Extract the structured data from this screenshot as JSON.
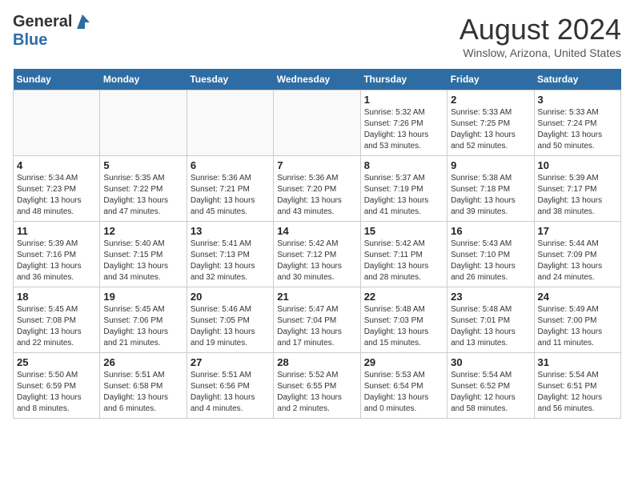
{
  "header": {
    "logo_general": "General",
    "logo_blue": "Blue",
    "month_title": "August 2024",
    "location": "Winslow, Arizona, United States"
  },
  "weekdays": [
    "Sunday",
    "Monday",
    "Tuesday",
    "Wednesday",
    "Thursday",
    "Friday",
    "Saturday"
  ],
  "weeks": [
    [
      {
        "day": "",
        "info": ""
      },
      {
        "day": "",
        "info": ""
      },
      {
        "day": "",
        "info": ""
      },
      {
        "day": "",
        "info": ""
      },
      {
        "day": "1",
        "info": "Sunrise: 5:32 AM\nSunset: 7:26 PM\nDaylight: 13 hours\nand 53 minutes."
      },
      {
        "day": "2",
        "info": "Sunrise: 5:33 AM\nSunset: 7:25 PM\nDaylight: 13 hours\nand 52 minutes."
      },
      {
        "day": "3",
        "info": "Sunrise: 5:33 AM\nSunset: 7:24 PM\nDaylight: 13 hours\nand 50 minutes."
      }
    ],
    [
      {
        "day": "4",
        "info": "Sunrise: 5:34 AM\nSunset: 7:23 PM\nDaylight: 13 hours\nand 48 minutes."
      },
      {
        "day": "5",
        "info": "Sunrise: 5:35 AM\nSunset: 7:22 PM\nDaylight: 13 hours\nand 47 minutes."
      },
      {
        "day": "6",
        "info": "Sunrise: 5:36 AM\nSunset: 7:21 PM\nDaylight: 13 hours\nand 45 minutes."
      },
      {
        "day": "7",
        "info": "Sunrise: 5:36 AM\nSunset: 7:20 PM\nDaylight: 13 hours\nand 43 minutes."
      },
      {
        "day": "8",
        "info": "Sunrise: 5:37 AM\nSunset: 7:19 PM\nDaylight: 13 hours\nand 41 minutes."
      },
      {
        "day": "9",
        "info": "Sunrise: 5:38 AM\nSunset: 7:18 PM\nDaylight: 13 hours\nand 39 minutes."
      },
      {
        "day": "10",
        "info": "Sunrise: 5:39 AM\nSunset: 7:17 PM\nDaylight: 13 hours\nand 38 minutes."
      }
    ],
    [
      {
        "day": "11",
        "info": "Sunrise: 5:39 AM\nSunset: 7:16 PM\nDaylight: 13 hours\nand 36 minutes."
      },
      {
        "day": "12",
        "info": "Sunrise: 5:40 AM\nSunset: 7:15 PM\nDaylight: 13 hours\nand 34 minutes."
      },
      {
        "day": "13",
        "info": "Sunrise: 5:41 AM\nSunset: 7:13 PM\nDaylight: 13 hours\nand 32 minutes."
      },
      {
        "day": "14",
        "info": "Sunrise: 5:42 AM\nSunset: 7:12 PM\nDaylight: 13 hours\nand 30 minutes."
      },
      {
        "day": "15",
        "info": "Sunrise: 5:42 AM\nSunset: 7:11 PM\nDaylight: 13 hours\nand 28 minutes."
      },
      {
        "day": "16",
        "info": "Sunrise: 5:43 AM\nSunset: 7:10 PM\nDaylight: 13 hours\nand 26 minutes."
      },
      {
        "day": "17",
        "info": "Sunrise: 5:44 AM\nSunset: 7:09 PM\nDaylight: 13 hours\nand 24 minutes."
      }
    ],
    [
      {
        "day": "18",
        "info": "Sunrise: 5:45 AM\nSunset: 7:08 PM\nDaylight: 13 hours\nand 22 minutes."
      },
      {
        "day": "19",
        "info": "Sunrise: 5:45 AM\nSunset: 7:06 PM\nDaylight: 13 hours\nand 21 minutes."
      },
      {
        "day": "20",
        "info": "Sunrise: 5:46 AM\nSunset: 7:05 PM\nDaylight: 13 hours\nand 19 minutes."
      },
      {
        "day": "21",
        "info": "Sunrise: 5:47 AM\nSunset: 7:04 PM\nDaylight: 13 hours\nand 17 minutes."
      },
      {
        "day": "22",
        "info": "Sunrise: 5:48 AM\nSunset: 7:03 PM\nDaylight: 13 hours\nand 15 minutes."
      },
      {
        "day": "23",
        "info": "Sunrise: 5:48 AM\nSunset: 7:01 PM\nDaylight: 13 hours\nand 13 minutes."
      },
      {
        "day": "24",
        "info": "Sunrise: 5:49 AM\nSunset: 7:00 PM\nDaylight: 13 hours\nand 11 minutes."
      }
    ],
    [
      {
        "day": "25",
        "info": "Sunrise: 5:50 AM\nSunset: 6:59 PM\nDaylight: 13 hours\nand 8 minutes."
      },
      {
        "day": "26",
        "info": "Sunrise: 5:51 AM\nSunset: 6:58 PM\nDaylight: 13 hours\nand 6 minutes."
      },
      {
        "day": "27",
        "info": "Sunrise: 5:51 AM\nSunset: 6:56 PM\nDaylight: 13 hours\nand 4 minutes."
      },
      {
        "day": "28",
        "info": "Sunrise: 5:52 AM\nSunset: 6:55 PM\nDaylight: 13 hours\nand 2 minutes."
      },
      {
        "day": "29",
        "info": "Sunrise: 5:53 AM\nSunset: 6:54 PM\nDaylight: 13 hours\nand 0 minutes."
      },
      {
        "day": "30",
        "info": "Sunrise: 5:54 AM\nSunset: 6:52 PM\nDaylight: 12 hours\nand 58 minutes."
      },
      {
        "day": "31",
        "info": "Sunrise: 5:54 AM\nSunset: 6:51 PM\nDaylight: 12 hours\nand 56 minutes."
      }
    ]
  ]
}
